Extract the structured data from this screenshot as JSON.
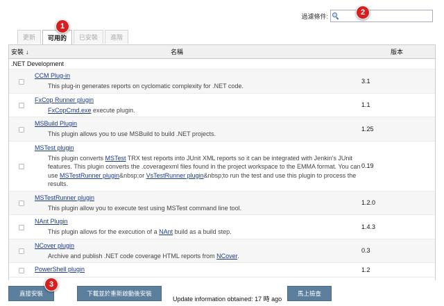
{
  "filter": {
    "label": "過濾條件:",
    "value": "",
    "icon": "search-icon"
  },
  "tabs": [
    {
      "label": "更新",
      "active": false
    },
    {
      "label": "可用的",
      "active": true
    },
    {
      "label": "已安裝",
      "active": false
    },
    {
      "label": "進階",
      "active": false
    }
  ],
  "table": {
    "col_install": "安裝",
    "sort_indicator": "↓",
    "col_name": "名稱",
    "col_version": "版本",
    "category": ".NET Development",
    "plugins": [
      {
        "name": "CCM Plug-in",
        "version": "3.1",
        "desc": [
          {
            "t": "This plug-in generates reports on cyclomatic complexity for .NET code."
          }
        ]
      },
      {
        "name": "FxCop Runner plugin",
        "version": "1.1",
        "desc": [
          {
            "t": "FxCopCmd.exe",
            "link": true
          },
          {
            "t": " execute plugin."
          }
        ]
      },
      {
        "name": "MSBuild Plugin",
        "version": "1.25",
        "desc": [
          {
            "t": "This plugin allows you to use MSBuild to build .NET projects."
          }
        ]
      },
      {
        "name": "MSTest plugin",
        "version": "0.19",
        "desc": [
          {
            "t": "This plugin converts "
          },
          {
            "t": "MSTest",
            "link": true
          },
          {
            "t": " TRX test reports into JUnit XML reports so it can be integrated with Jenkin's JUnit features. This plugin converts the .coveragexml files found in the project workspace to the EMMA format. You can use "
          },
          {
            "t": "MSTestRunner plugin",
            "link": true
          },
          {
            "t": "&nbsp;or "
          },
          {
            "t": "VsTestRunner plugin",
            "link": true
          },
          {
            "t": "&nbsp;to run the test and use this plugin to process the results."
          }
        ]
      },
      {
        "name": "MSTestRunner plugin",
        "version": "1.2.0",
        "desc": [
          {
            "t": "This plugin allow you to execute test using MSTest command line tool."
          }
        ]
      },
      {
        "name": "NAnt Plugin",
        "version": "1.4.3",
        "desc": [
          {
            "t": "This plugin allows for the execution of a "
          },
          {
            "t": "NAnt",
            "link": true
          },
          {
            "t": " build as a build step."
          }
        ]
      },
      {
        "name": "NCover plugin",
        "version": "0.3",
        "desc": [
          {
            "t": "Archive and publish .NET code coverage HTML reports from "
          },
          {
            "t": "NCover",
            "link": true
          },
          {
            "t": "."
          }
        ]
      },
      {
        "name": "PowerShell plugin",
        "version": "1.2",
        "desc": []
      }
    ]
  },
  "footer": {
    "install_button": "直接安裝",
    "download_button": "下載並於重新啟動後安裝",
    "update_info": "Update information obtained: 17 時 ago",
    "check_button": "馬上檢查"
  },
  "badges": [
    "1",
    "2",
    "3"
  ],
  "colors": {
    "button": "#5c7f9e",
    "badge": "#d62020",
    "link": "#1a3a8c"
  }
}
